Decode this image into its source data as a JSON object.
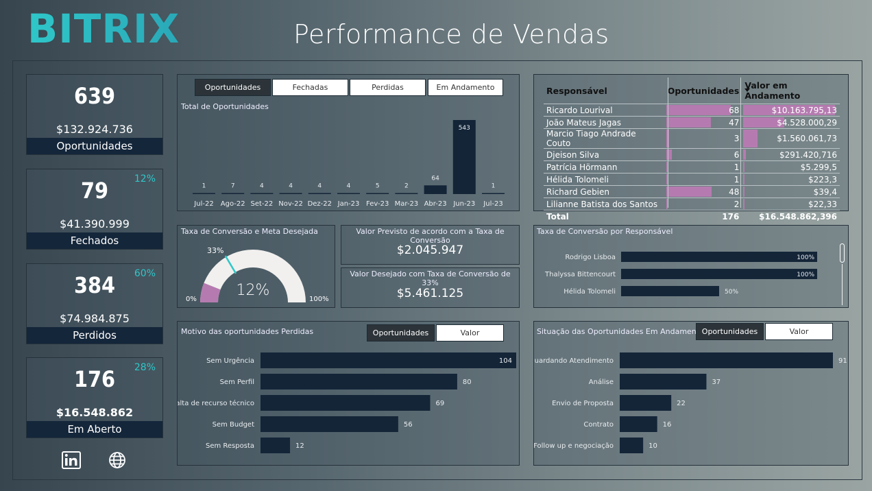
{
  "header": {
    "logo": "BITRIX",
    "title": "Performance de Vendas"
  },
  "kpis": [
    {
      "value": "639",
      "amount": "$132.924.736",
      "label": "Oportunidades",
      "pct": ""
    },
    {
      "value": "79",
      "amount": "$41.390.999",
      "label": "Fechados",
      "pct": "12%"
    },
    {
      "value": "384",
      "amount": "$74.984.875",
      "label": "Perdidos",
      "pct": "60%"
    },
    {
      "value": "176",
      "amount": "$16.548.862",
      "label": "Em Aberto",
      "pct": "28%"
    }
  ],
  "footer_icons": [
    "linkedin-icon",
    "globe-icon"
  ],
  "opp_chart": {
    "tabs": [
      "Oportunidades",
      "Fechadas",
      "Perdidas",
      "Em Andamento"
    ],
    "active_tab": "Oportunidades",
    "subtitle": "Total de Oportunidades"
  },
  "gauge": {
    "title": "Taxa de Conversão e Meta Desejada",
    "value_label": "12%",
    "target_label": "33%",
    "min_label": "0%",
    "max_label": "100%",
    "value": 12,
    "target": 33
  },
  "predicted": {
    "title": "Valor Previsto de acordo com a Taxa de Conversão",
    "value": "$2.045.947"
  },
  "desired": {
    "title": "Valor Desejado com Taxa de Conversão de 33%",
    "value": "$5.461.125"
  },
  "resp_table": {
    "headers": [
      "Responsável",
      "Oportunidades",
      "Valor em Andamento"
    ],
    "rows": [
      {
        "name": "Ricardo Lourival",
        "opp": "68",
        "val": "$10.163.795,13",
        "opp_n": 68,
        "val_n": 10163795.13
      },
      {
        "name": "João Mateus Jagas",
        "opp": "47",
        "val": "$4.528.000,29",
        "opp_n": 47,
        "val_n": 4528000.29
      },
      {
        "name": "Marcio Tiago Andrade Couto",
        "opp": "3",
        "val": "$1.560.061,73",
        "opp_n": 3,
        "val_n": 1560061.73
      },
      {
        "name": "Djeison Silva",
        "opp": "6",
        "val": "$291.420,716",
        "opp_n": 6,
        "val_n": 291420.716
      },
      {
        "name": "Patrícia Hörmann",
        "opp": "1",
        "val": "$5.299,5",
        "opp_n": 1,
        "val_n": 5299.5
      },
      {
        "name": "Hélida Tolomeli",
        "opp": "1",
        "val": "$223,3",
        "opp_n": 1,
        "val_n": 223.3
      },
      {
        "name": "Richard Gebien",
        "opp": "48",
        "val": "$39,4",
        "opp_n": 48,
        "val_n": 39.4
      },
      {
        "name": "Lilianne Batista dos Santos",
        "opp": "2",
        "val": "$22,33",
        "opp_n": 2,
        "val_n": 22.33
      }
    ],
    "total": {
      "label": "Total",
      "opp": "176",
      "val": "$16.548.862,396"
    }
  },
  "conv_by_resp": {
    "title": "Taxa de Conversão por Responsável"
  },
  "lost_reasons": {
    "title": "Motivo das oportunidades Perdidas",
    "tabs": [
      "Oportunidades",
      "Valor"
    ],
    "active_tab": "Oportunidades"
  },
  "in_progress": {
    "title": "Situação das Oportunidades Em Andamento",
    "tabs": [
      "Oportunidades",
      "Valor"
    ],
    "active_tab": "Oportunidades"
  },
  "colors": {
    "bar": "#142538",
    "accent": "#2fc7c9",
    "magenta": "#b57bb0"
  },
  "chart_data": [
    {
      "type": "bar",
      "title": "Total de Oportunidades",
      "categories": [
        "Jul-22",
        "Ago-22",
        "Set-22",
        "Nov-22",
        "Dez-22",
        "Jan-23",
        "Fev-23",
        "Mar-23",
        "Abr-23",
        "Jun-23",
        "Jul-23"
      ],
      "values": [
        1,
        7,
        4,
        4,
        4,
        4,
        5,
        2,
        64,
        543,
        1
      ],
      "ylim": [
        0,
        543
      ]
    },
    {
      "type": "bar",
      "orientation": "horizontal",
      "title": "Taxa de Conversão por Responsável",
      "categories": [
        "Rodrigo Lisboa",
        "Thalyssa Bittencourt",
        "Hélida Tolomeli"
      ],
      "values": [
        100,
        100,
        50
      ],
      "value_labels": [
        "100%",
        "100%",
        "50%"
      ],
      "xlim": [
        0,
        100
      ]
    },
    {
      "type": "bar",
      "orientation": "horizontal",
      "title": "Motivo das oportunidades Perdidas",
      "categories": [
        "Sem Urgência",
        "Sem Perfil",
        "Falta de recurso técnico",
        "Sem Budget",
        "Sem Resposta"
      ],
      "values": [
        104,
        80,
        69,
        56,
        12
      ]
    },
    {
      "type": "bar",
      "orientation": "horizontal",
      "title": "Situação das Oportunidades Em Andamento",
      "categories": [
        "Aguardando Atendimento",
        "Análise",
        "Envio de Proposta",
        "Contrato",
        "Follow up e negociação"
      ],
      "values": [
        91,
        37,
        22,
        16,
        10
      ]
    }
  ]
}
